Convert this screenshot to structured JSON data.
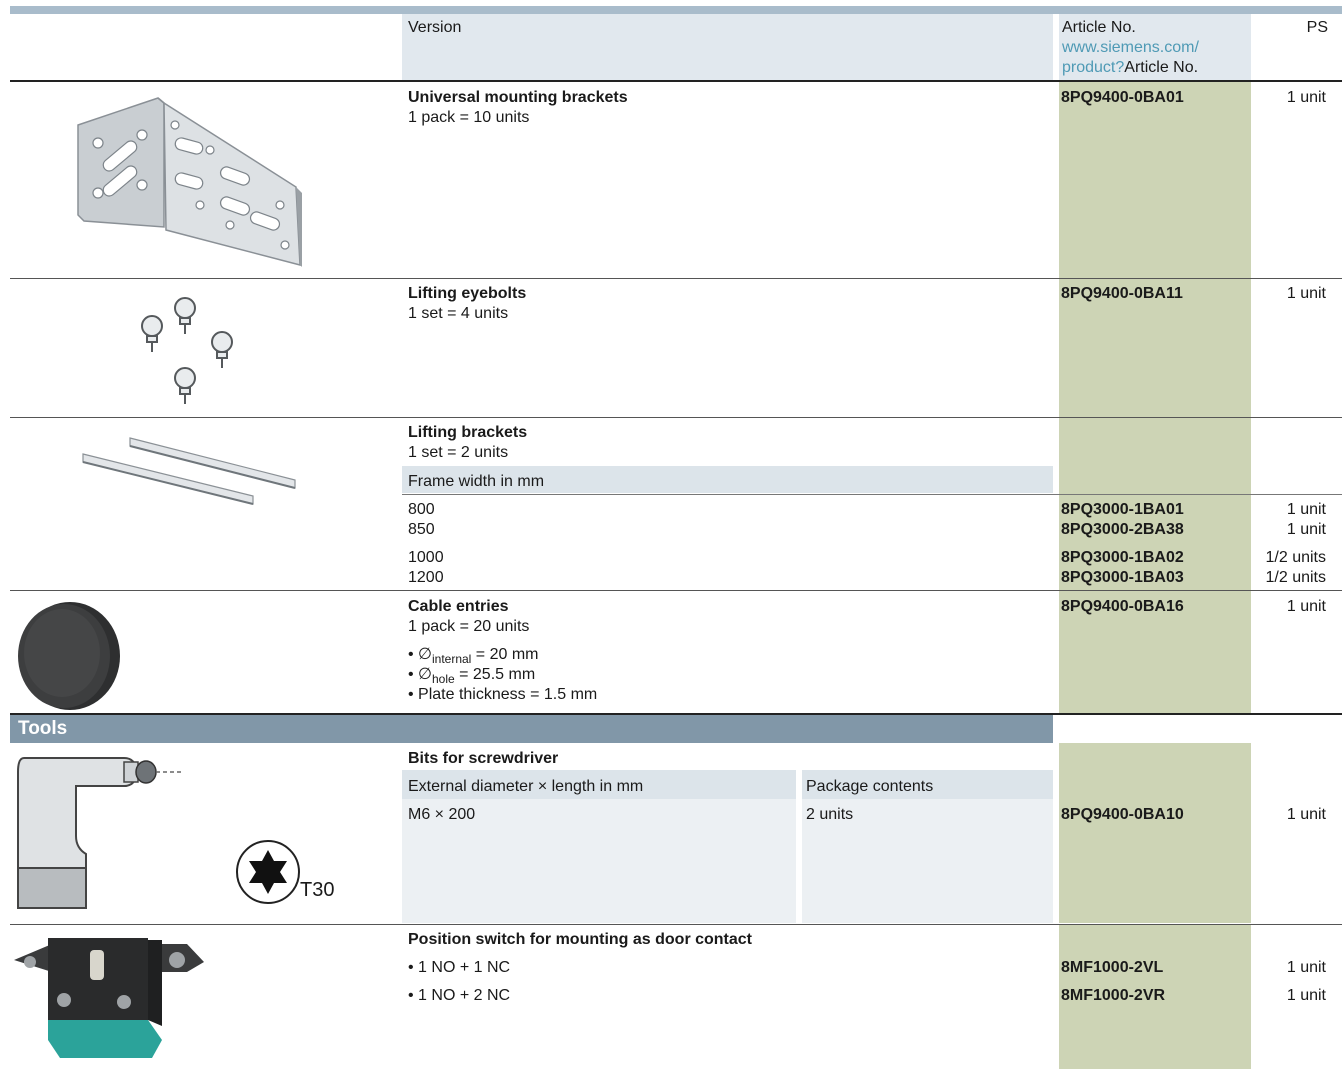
{
  "header": {
    "version": "Version",
    "article_no": "Article No.",
    "link_line1": "www.siemens.com/",
    "link_line2": "product?",
    "link_suffix": "Article No.",
    "ps": "PS"
  },
  "rows": {
    "mounting": {
      "title": "Universal mounting brackets",
      "sub": "1 pack = 10 units",
      "article": "8PQ9400-0BA01",
      "ps": "1 unit"
    },
    "eyebolts": {
      "title": "Lifting eyebolts",
      "sub": "1 set = 4 units",
      "article": "8PQ9400-0BA11",
      "ps": "1 unit"
    },
    "brackets": {
      "title": "Lifting brackets",
      "sub": "1 set = 2 units",
      "subhead": "Frame width in mm",
      "items": [
        {
          "width": "800",
          "article": "8PQ3000-1BA01",
          "ps": "1 unit"
        },
        {
          "width": "850",
          "article": "8PQ3000-2BA38",
          "ps": "1 unit"
        },
        {
          "width": "1000",
          "article": "8PQ3000-1BA02",
          "ps": "1/2 units"
        },
        {
          "width": "1200",
          "article": "8PQ3000-1BA03",
          "ps": "1/2 units"
        }
      ]
    },
    "cable": {
      "title": "Cable entries",
      "sub": "1 pack = 20 units",
      "bullet1_pre": "• ∅",
      "bullet1_sub": "internal",
      "bullet1_post": " = 20 mm",
      "bullet2_pre": "• ∅",
      "bullet2_sub": "hole",
      "bullet2_post": " = 25.5 mm",
      "bullet3": "• Plate thickness = 1.5 mm",
      "article": "8PQ9400-0BA16",
      "ps": "1 unit"
    }
  },
  "tools": {
    "label": "Tools",
    "bits": {
      "title": "Bits for screwdriver",
      "col1": "External diameter × length in mm",
      "col2": "Package contents",
      "size": "M6 × 200",
      "contents": "2 units",
      "article": "8PQ9400-0BA10",
      "ps": "1 unit",
      "torx_label": "T30"
    },
    "switch": {
      "title": "Position switch for mounting as door contact",
      "items": [
        {
          "label": "• 1 NO + 1 NC",
          "article": "8MF1000-2VL",
          "ps": "1 unit"
        },
        {
          "label": "• 1 NO + 2 NC",
          "article": "8MF1000-2VR",
          "ps": "1 unit"
        }
      ]
    }
  },
  "colors": {
    "article_column": "#cdd4b5",
    "tools_bar": "#8197a8",
    "header_bg": "#e1e8ee"
  }
}
